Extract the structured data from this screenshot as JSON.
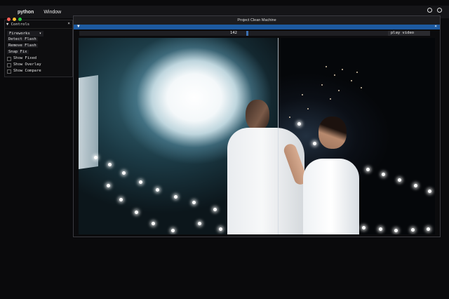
{
  "menubar": {
    "apple_glyph": "",
    "app_name": "python",
    "menus": [
      "Window"
    ]
  },
  "controls": {
    "title": "Controls",
    "close_glyph": "×",
    "preset": "Fireworks",
    "buttons": [
      "Detect Flash",
      "Remove Flash",
      "Snap Fix"
    ],
    "checkboxes": [
      "Show Fixed",
      "Show Overlay",
      "Show Compare"
    ]
  },
  "window": {
    "title": "Project Clean Machine",
    "collapse_glyph": "▼",
    "close_glyph": "×"
  },
  "toolbar": {
    "frame_value": "142",
    "play_label": "play video"
  },
  "colors": {
    "accent_blue": "#1d5aa0",
    "traffic_red": "#ff5f57",
    "traffic_yellow": "#febc2e",
    "traffic_green": "#28c840"
  }
}
